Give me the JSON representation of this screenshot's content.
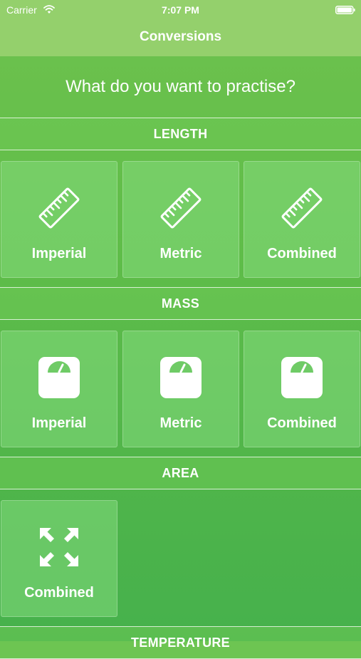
{
  "status_bar": {
    "carrier": "Carrier",
    "time": "7:07 PM",
    "icons": [
      "wifi-icon",
      "battery-icon"
    ]
  },
  "nav": {
    "title": "Conversions"
  },
  "prompt": "What do you want to practise?",
  "sections": {
    "length": {
      "title": "LENGTH",
      "icon": "ruler-icon",
      "items": [
        {
          "label": "Imperial"
        },
        {
          "label": "Metric"
        },
        {
          "label": "Combined"
        }
      ]
    },
    "mass": {
      "title": "MASS",
      "icon": "scale-icon",
      "items": [
        {
          "label": "Imperial"
        },
        {
          "label": "Metric"
        },
        {
          "label": "Combined"
        }
      ]
    },
    "area": {
      "title": "AREA",
      "icon": "expand-arrows-icon",
      "items": [
        {
          "label": "Combined"
        }
      ]
    },
    "temperature": {
      "title": "TEMPERATURE"
    }
  },
  "colors": {
    "top_bar": "#94d06c",
    "background_top": "#6ec24e",
    "background_bottom": "#46b14c",
    "text": "#ffffff"
  }
}
